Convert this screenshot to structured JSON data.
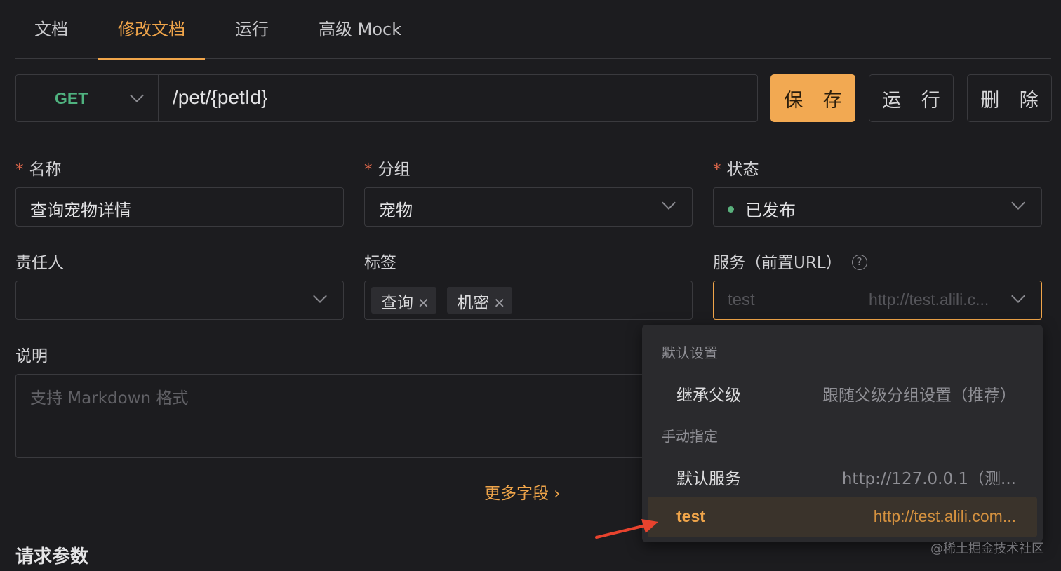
{
  "tabs": [
    "文档",
    "修改文档",
    "运行",
    "高级 Mock"
  ],
  "url_bar": {
    "method": "GET",
    "path": "/pet/{petId}",
    "save_label": "保 存",
    "run_label": "运 行",
    "delete_label": "删 除"
  },
  "form": {
    "required_mark": "*",
    "name_label": "名称",
    "name_value": "查询宠物详情",
    "group_label": "分组",
    "group_value": "宠物",
    "status_label": "状态",
    "status_value": "已发布",
    "owner_label": "责任人",
    "owner_value": "",
    "tags_label": "标签",
    "tags": [
      "查询",
      "机密"
    ],
    "service_label": "服务（前置URL）",
    "service_help": "?",
    "service_value": "test",
    "service_url": "http://test.alili.c...",
    "description_label": "说明",
    "description_placeholder": "支持 Markdown 格式",
    "more_fields": "更多字段 ›"
  },
  "dropdown": {
    "group_default": "默认设置",
    "inherit_name": "继承父级",
    "inherit_desc": "跟随父级分组设置（推荐）",
    "group_manual": "手动指定",
    "default_service_name": "默认服务",
    "default_service_url": "http://127.0.0.1（测...",
    "test_name": "test",
    "test_url": "http://test.alili.com..."
  },
  "section_title": "请求参数",
  "watermark": "@稀土掘金技术社区",
  "colors": {
    "accent": "#f0a54a",
    "method_get": "#4fb27f",
    "status_published": "#59b07c",
    "arrow": "#e8432e"
  }
}
